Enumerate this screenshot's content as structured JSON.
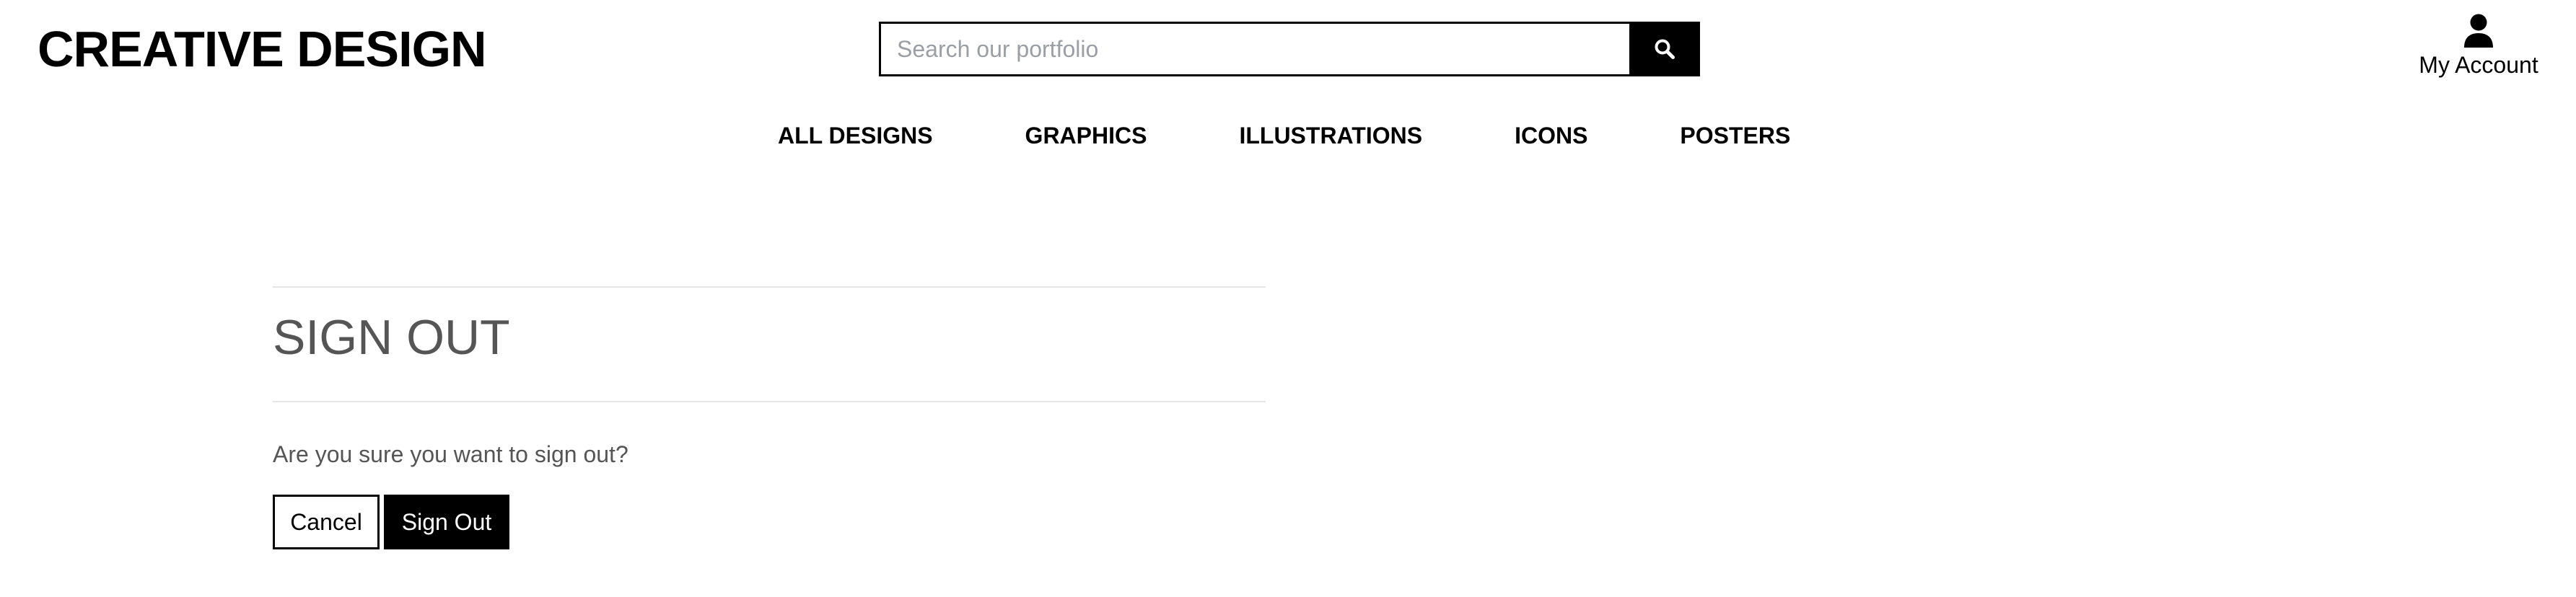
{
  "header": {
    "logo_text": "CREATIVE DESIGN",
    "search": {
      "placeholder": "Search our portfolio",
      "value": ""
    },
    "account": {
      "icon": "user-icon",
      "label": "My Account"
    }
  },
  "nav": {
    "items": [
      {
        "label": "ALL DESIGNS"
      },
      {
        "label": "GRAPHICS"
      },
      {
        "label": "ILLUSTRATIONS"
      },
      {
        "label": "ICONS"
      },
      {
        "label": "POSTERS"
      }
    ]
  },
  "main": {
    "title": "SIGN OUT",
    "message": "Are you sure you want to sign out?",
    "cancel_label": "Cancel",
    "signout_label": "Sign Out"
  },
  "colors": {
    "primary": "#000000",
    "title_text": "#555555",
    "divider": "#e5e5e5",
    "placeholder": "#9a9fa6"
  }
}
